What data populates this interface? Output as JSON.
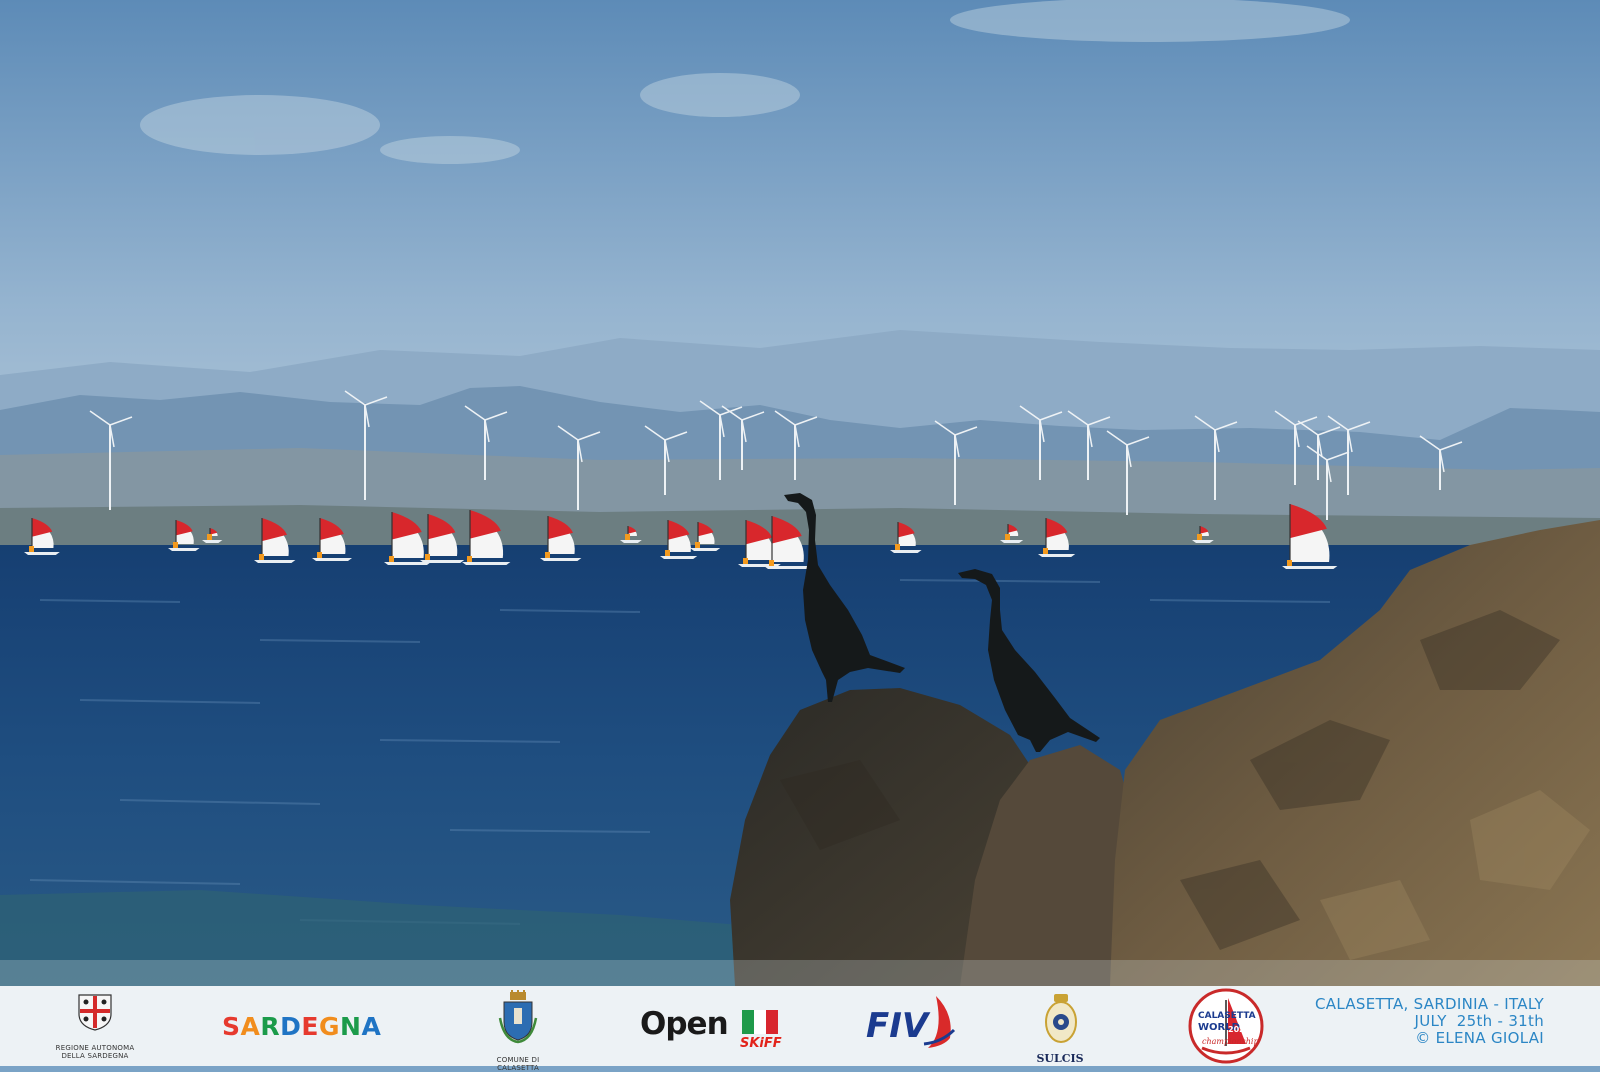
{
  "scene": {
    "colors": {
      "sky_top": "#6c96bd",
      "sky_bottom": "#b7cad9",
      "mountains": "#7c9bb8",
      "sea": "#1f4f82",
      "sea_deep": "#0f3561",
      "rock": "#3f3a30",
      "rock_light": "#7d6b4f",
      "sail_red": "#d8272c",
      "sail_white": "#f5f5f5",
      "bird": "#161a1b"
    }
  },
  "sponsors": {
    "regione": {
      "icon": "sardinia-flag-crest-icon",
      "caption_line1": "REGIONE AUTONOMA",
      "caption_line2": "DELLA SARDEGNA"
    },
    "sardegna": {
      "text": "SARDEGNA",
      "letter_colors": [
        "#e63a2e",
        "#f18d1d",
        "#1b9b4a",
        "#1f74c4",
        "#e63a2e",
        "#f18d1d",
        "#1b9b4a",
        "#1f74c4"
      ]
    },
    "comune": {
      "icon": "calasetta-coat-of-arms-icon",
      "caption": "COMUNE DI CALASETTA"
    },
    "open_skiff": {
      "text": "Open",
      "subtext": "SKiFF",
      "icon": "italian-flag-icon"
    },
    "fiv": {
      "text": "FIV",
      "icon": "sail-swoosh-icon"
    },
    "sulcis": {
      "icon": "sulcis-crest-icon",
      "text": "SULCIS"
    },
    "championship": {
      "icon": "world-championship-badge-icon",
      "text_top": "CALASETTA",
      "text_mid": "WORLD",
      "text_year": "2026",
      "text_bottom": "championship"
    }
  },
  "event": {
    "location": "CALASETTA, SARDINIA - ITALY",
    "dates": "JULY  25th - 31th",
    "credit": "© ELENA GIOLAI"
  }
}
